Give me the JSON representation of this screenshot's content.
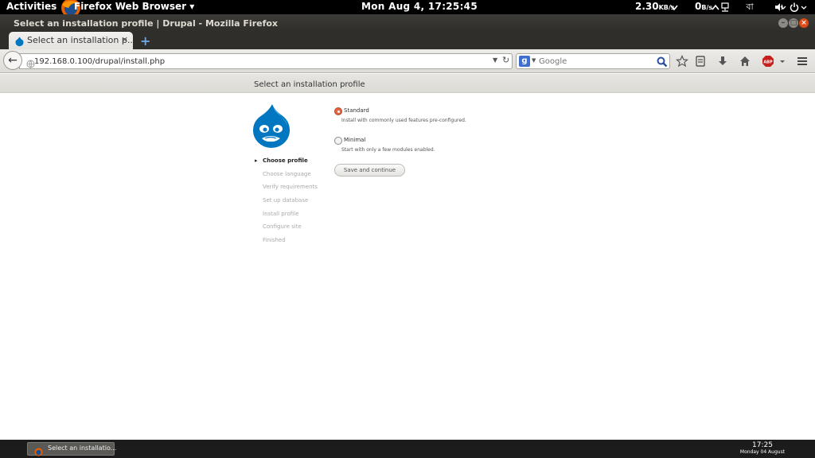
{
  "topbar": {
    "activities": "Activities",
    "app_menu": "Firefox Web Browser ▾",
    "clock": "Mon Aug  4, 17:25:45",
    "net_down_value": "2.30",
    "net_down_unit": "KB/s",
    "net_up_value": "0",
    "net_up_unit": "B/s",
    "icons": [
      "chevron-down-icon",
      "chevron-up-icon",
      "network-icon",
      "keyboard-layout-icon",
      "volume-icon",
      "chevron-down-icon",
      "power-icon",
      "chevron-down-icon"
    ],
    "keyboard_layout": "বা"
  },
  "window": {
    "title": "Select an installation profile | Drupal - Mozilla Firefox"
  },
  "tabs": [
    {
      "title": "Select an installation p...",
      "close": "×"
    }
  ],
  "new_tab": "+",
  "navbar": {
    "back": "←",
    "url": "192.168.0.100/drupal/install.php",
    "search_engine": "g",
    "search_placeholder": "Google",
    "toolbar_icons": [
      "bookmark-star-icon",
      "reading-list-icon",
      "download-icon",
      "home-icon",
      "adblock-icon",
      "menu-icon"
    ],
    "adblock_label": "ABP"
  },
  "page": {
    "header_title": "Select an installation profile",
    "steps": [
      {
        "label": "Choose profile",
        "active": true
      },
      {
        "label": "Choose language",
        "active": false
      },
      {
        "label": "Verify requirements",
        "active": false
      },
      {
        "label": "Set up database",
        "active": false
      },
      {
        "label": "Install profile",
        "active": false
      },
      {
        "label": "Configure site",
        "active": false
      },
      {
        "label": "Finished",
        "active": false
      }
    ],
    "profiles": [
      {
        "name": "Standard",
        "description": "Install with commonly used features pre-configured.",
        "selected": true
      },
      {
        "name": "Minimal",
        "description": "Start with only a few modules enabled.",
        "selected": false
      }
    ],
    "save_button": "Save and continue"
  },
  "taskbar": {
    "window_label": "Select an installatio...",
    "time": "17:25",
    "date": "Monday 04 August"
  },
  "colors": {
    "drupal_blue": "#0077c0",
    "radio_selected": "#e6643e",
    "topbar": "#000000",
    "titlebar": "#3c3b37"
  }
}
